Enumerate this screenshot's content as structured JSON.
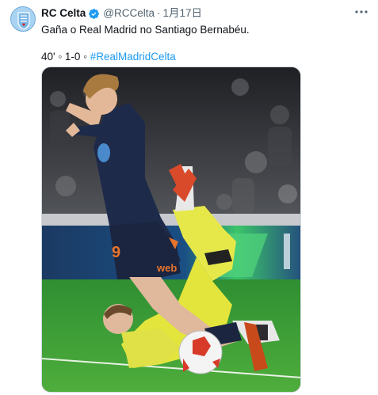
{
  "account": {
    "name": "RC Celta",
    "handle": "@RCCelta",
    "separator": "·",
    "date": "1月17日"
  },
  "tweet": {
    "text_line1": "Gaña o Real Madrid no Santiago Bernabéu.",
    "score_text": "40' ◦ 1-0 ◦ ",
    "hashtag": "#RealMadridCelta"
  },
  "media": {
    "shirt_number": "9",
    "sponsor_text": "web"
  },
  "icons": {
    "verified": "verified-badge-icon",
    "more": "more-options-icon",
    "avatar": "celta-crest-avatar"
  },
  "colors": {
    "accent": "#1d9bf0",
    "text": "#0f1419",
    "secondary": "#536471"
  }
}
